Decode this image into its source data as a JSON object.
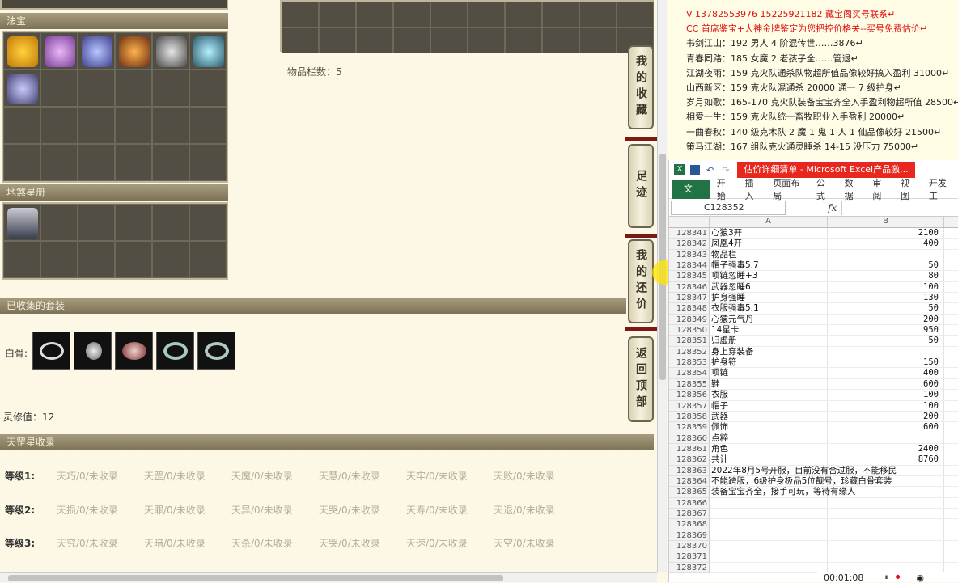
{
  "game": {
    "fabao_header": "法宝",
    "earth_header": "地煞星册",
    "storage_count_label": "物品栏数：5",
    "collected_sets_header": "已收集的套装",
    "white_bone_label": "白骨:",
    "lingxiu_label": "灵修值：12",
    "heaven_header": "天罡星收录",
    "side_buttons": [
      "我的收藏",
      "足迹",
      "我的还价",
      "返回顶部"
    ],
    "tiers": [
      {
        "label": "等级1:",
        "items": [
          "天巧/0/未收录",
          "天罡/0/未收录",
          "天魔/0/未收录",
          "天慧/0/未收录",
          "天牢/0/未收录",
          "天败/0/未收录"
        ]
      },
      {
        "label": "等级2:",
        "items": [
          "天损/0/未收录",
          "天罪/0/未收录",
          "天异/0/未收录",
          "天哭/0/未收录",
          "天寿/0/未收录",
          "天退/0/未收录"
        ]
      },
      {
        "label": "等级3:",
        "items": [
          "天究/0/未收录",
          "天暗/0/未收录",
          "天杀/0/未收录",
          "天哭/0/未收录",
          "天速/0/未收录",
          "天空/0/未收录"
        ]
      }
    ],
    "colors": {
      "header": "#8a8066",
      "panel": "#fdf8e6",
      "cell": "#524e44",
      "rail": "#7a1a12"
    }
  },
  "notes": {
    "lines": [
      {
        "text": "V 13782553976    15225921182   藏宝阁买号联系↵",
        "color": "red"
      },
      {
        "text": "CC 首席鉴宝+大神金牌鉴定为您把控价格关--买号免费估价↵",
        "color": "red"
      },
      {
        "text": "书剑江山：192 男人 4 阶混传世……3876↵",
        "color": "black"
      },
      {
        "text": "青春同路：185 女魔 2 老孩子全……管退↵",
        "color": "black"
      },
      {
        "text": "江湖夜雨：159 克火队通杀队物超所值品像较好搞入盈利 31000↵",
        "color": "black"
      },
      {
        "text": "山西新区：159 克火队混通杀 20000 通一 7 级护身↵",
        "color": "black"
      },
      {
        "text": "岁月如歌：165-170 克火队装备宝宝齐全入手盈利物超所值 28500↵",
        "color": "black"
      },
      {
        "text": "相爱一生：159 克火队统一畜牧职业入手盈利 20000↵",
        "color": "black"
      },
      {
        "text": "一曲春秋：140 级克木队 2 魔 1 鬼 1 人 1 仙品像较好 21500↵",
        "color": "black"
      },
      {
        "text": "策马江湖：167 组队克火通灵睡杀 14-15 没压力 75000↵",
        "color": "black"
      }
    ]
  },
  "excel": {
    "window_title": "估价详细清单 - Microsoft Excel产品激...",
    "ribbon": [
      "文件",
      "开始",
      "插入",
      "页面布局",
      "公式",
      "数据",
      "审阅",
      "视图",
      "开发工"
    ],
    "name_box": "C128352",
    "fx": "fx",
    "col_a": "A",
    "col_b": "B",
    "rows": [
      {
        "n": "128341",
        "a": "心猿3开",
        "b": "2100"
      },
      {
        "n": "128342",
        "a": "凤凰4开",
        "b": "400"
      },
      {
        "n": "128343",
        "a": "物品栏",
        "b": ""
      },
      {
        "n": "128344",
        "a": "帽子强毒5.7",
        "b": "50"
      },
      {
        "n": "128345",
        "a": "项链忽睡+3",
        "b": "80"
      },
      {
        "n": "128346",
        "a": "武器忽睡6",
        "b": "100"
      },
      {
        "n": "128347",
        "a": "护身强睡",
        "b": "130"
      },
      {
        "n": "128348",
        "a": "衣服强毒5.1",
        "b": "50"
      },
      {
        "n": "128349",
        "a": "心猿元气丹",
        "b": "200"
      },
      {
        "n": "128350",
        "a": "14星卡",
        "b": "950"
      },
      {
        "n": "128351",
        "a": "归虚册",
        "b": "50"
      },
      {
        "n": "128352",
        "a": "身上穿装备",
        "b": ""
      },
      {
        "n": "128353",
        "a": "护身符",
        "b": "150"
      },
      {
        "n": "128354",
        "a": "项链",
        "b": "400"
      },
      {
        "n": "128355",
        "a": "鞋",
        "b": "600"
      },
      {
        "n": "128356",
        "a": "衣服",
        "b": "100"
      },
      {
        "n": "128357",
        "a": "帽子",
        "b": "100"
      },
      {
        "n": "128358",
        "a": "武器",
        "b": "200"
      },
      {
        "n": "128359",
        "a": "佩饰",
        "b": "600"
      },
      {
        "n": "128360",
        "a": "点粹",
        "b": ""
      },
      {
        "n": "128361",
        "a": "角色",
        "b": "2400"
      },
      {
        "n": "128362",
        "a": "共计",
        "b": "8760"
      },
      {
        "n": "128363",
        "a": "2022年8月5号开服，目前没有合过服，不能移民",
        "b": ""
      },
      {
        "n": "128364",
        "a": "不能跨服，6级护身极品5位靓号，珍藏白骨套装",
        "b": ""
      },
      {
        "n": "128365",
        "a": "装备宝宝齐全，接手可玩，等待有缘人",
        "b": ""
      },
      {
        "n": "128366",
        "a": "",
        "b": ""
      },
      {
        "n": "128367",
        "a": "",
        "b": ""
      },
      {
        "n": "128368",
        "a": "",
        "b": ""
      },
      {
        "n": "128369",
        "a": "",
        "b": ""
      },
      {
        "n": "128370",
        "a": "",
        "b": ""
      },
      {
        "n": "128371",
        "a": "",
        "b": ""
      },
      {
        "n": "128372",
        "a": "",
        "b": ""
      }
    ]
  },
  "recorder": {
    "time": "00:01:08"
  }
}
